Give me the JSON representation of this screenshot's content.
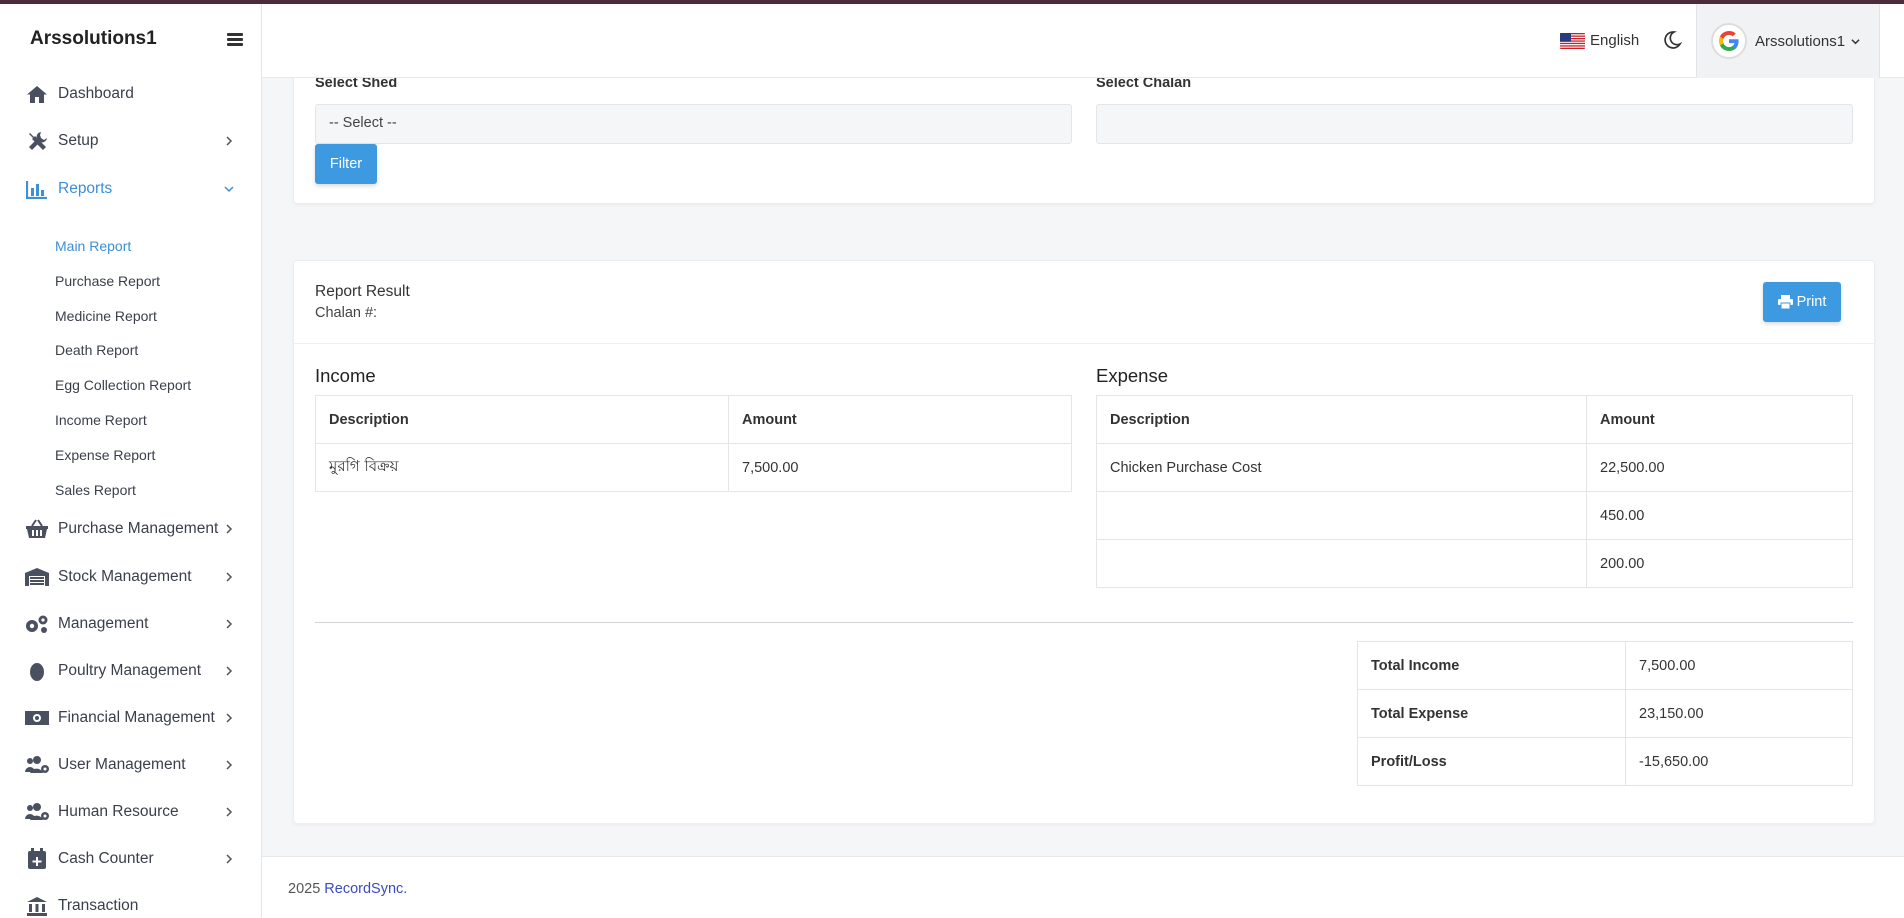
{
  "app": {
    "name": "Arssolutions1"
  },
  "header": {
    "language": "English",
    "user_name": "Arssolutions1"
  },
  "sidebar": {
    "items": [
      {
        "label": "Dashboard"
      },
      {
        "label": "Setup"
      },
      {
        "label": "Reports"
      },
      {
        "label": "Purchase Management"
      },
      {
        "label": "Stock Management"
      },
      {
        "label": "Management"
      },
      {
        "label": "Poultry Management"
      },
      {
        "label": "Financial Management"
      },
      {
        "label": "User Management"
      },
      {
        "label": "Human Resource"
      },
      {
        "label": "Cash Counter"
      },
      {
        "label": "Transaction"
      }
    ],
    "reports_sub": [
      {
        "label": "Main Report"
      },
      {
        "label": "Purchase Report"
      },
      {
        "label": "Medicine Report"
      },
      {
        "label": "Death Report"
      },
      {
        "label": "Egg Collection Report"
      },
      {
        "label": "Income Report"
      },
      {
        "label": "Expense Report"
      },
      {
        "label": "Sales Report"
      }
    ]
  },
  "filter": {
    "shed_label": "Select Shed",
    "shed_value": "-- Select --",
    "chalan_label": "Select Chalan",
    "chalan_value": "",
    "filter_button": "Filter"
  },
  "report": {
    "title": "Report Result",
    "chalan": "Chalan #:",
    "print_button": "Print",
    "income": {
      "title": "Income",
      "headers": [
        "Description",
        "Amount"
      ],
      "rows": [
        {
          "description": "মুরগি বিক্রয়",
          "amount": "7,500.00"
        }
      ]
    },
    "expense": {
      "title": "Expense",
      "headers": [
        "Description",
        "Amount"
      ],
      "rows": [
        {
          "description": "Chicken Purchase Cost",
          "amount": "22,500.00"
        },
        {
          "description": "",
          "amount": "450.00"
        },
        {
          "description": "",
          "amount": "200.00"
        }
      ]
    },
    "summary": [
      {
        "label": "Total Income",
        "value": "7,500.00"
      },
      {
        "label": "Total Expense",
        "value": "23,150.00"
      },
      {
        "label": "Profit/Loss",
        "value": "-15,650.00"
      }
    ]
  },
  "footer": {
    "year": "2025",
    "brand": "RecordSync."
  },
  "colors": {
    "accent": "#3d9ae0",
    "active_nav": "#3d8fd6",
    "top_bar": "#4a2c3a"
  }
}
